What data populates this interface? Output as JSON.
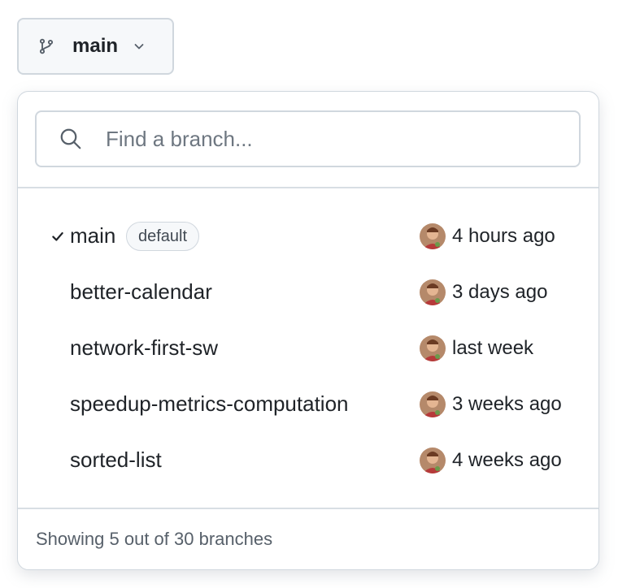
{
  "branch_button": {
    "label": "main"
  },
  "search": {
    "placeholder": "Find a branch...",
    "value": ""
  },
  "branches": [
    {
      "name": "main",
      "badge": "default",
      "selected": true,
      "updated": "4 hours ago"
    },
    {
      "name": "better-calendar",
      "selected": false,
      "updated": "3 days ago"
    },
    {
      "name": "network-first-sw",
      "selected": false,
      "updated": "last week"
    },
    {
      "name": "speedup-metrics-computation",
      "selected": false,
      "updated": "3 weeks ago"
    },
    {
      "name": "sorted-list",
      "selected": false,
      "updated": "4 weeks ago"
    }
  ],
  "footer": {
    "text": "Showing 5 out of 30 branches"
  },
  "icons": {
    "branch": "git-branch-icon",
    "chevron": "chevron-down-icon",
    "search": "search-icon",
    "check": "check-icon",
    "avatar": "avatar"
  },
  "colors": {
    "border": "#d0d7de",
    "text": "#1f2328",
    "muted": "#57606a",
    "placeholder": "#6e7781"
  }
}
